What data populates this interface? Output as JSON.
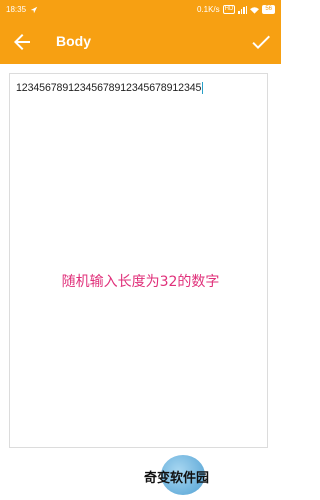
{
  "status_bar": {
    "time": "18:35",
    "network_speed": "0.1K/s",
    "hd_label": "HD",
    "battery": "56"
  },
  "toolbar": {
    "title": "Body",
    "back_icon": "arrow-left-icon",
    "confirm_icon": "check-icon"
  },
  "editor": {
    "value": "12345678912345678912345678912345"
  },
  "annotation": {
    "text": "随机输入长度为32的数字"
  },
  "watermark": {
    "text": "奇变软件园"
  },
  "colors": {
    "accent": "#f7a012",
    "annotation": "#e0307a",
    "caret": "#27a0c8"
  }
}
